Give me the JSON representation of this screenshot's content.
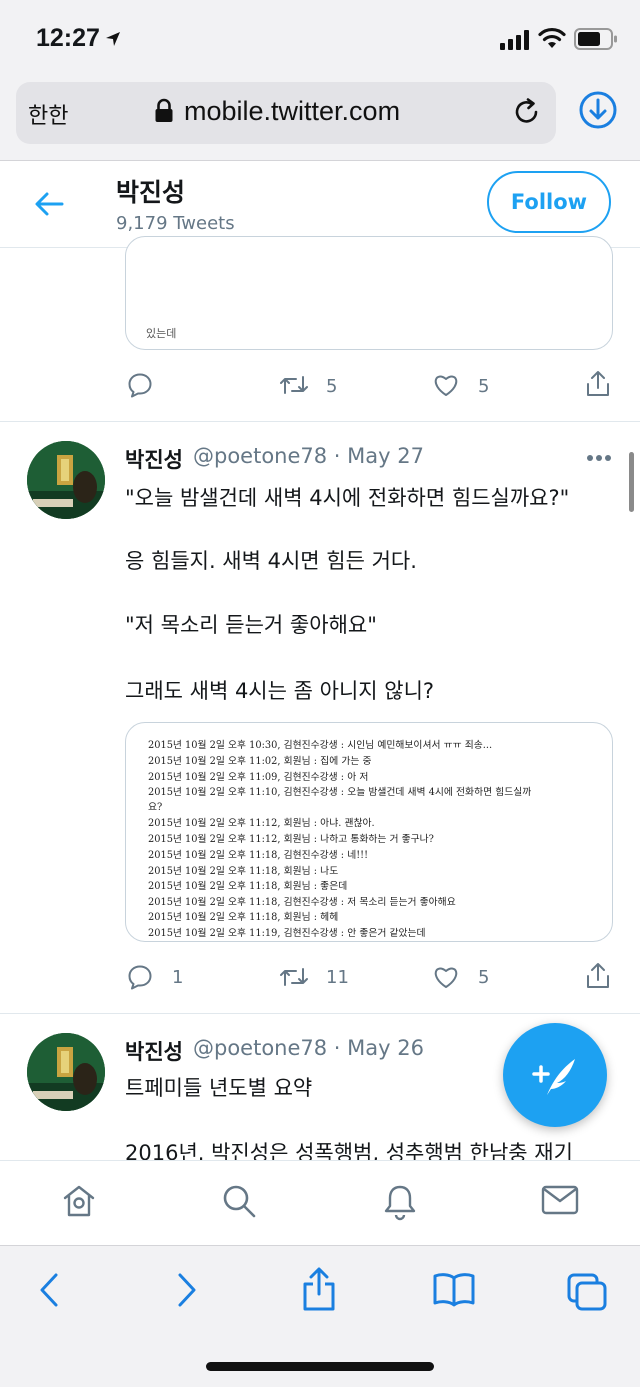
{
  "status": {
    "time": "12:27"
  },
  "browser": {
    "aa_label": "한한",
    "url": "mobile.twitter.com"
  },
  "profile": {
    "name": "박진성",
    "tweet_count": "9,179 Tweets",
    "follow_label": "Follow"
  },
  "prev_tweet": {
    "card_text": "있는데",
    "retweets": "5",
    "likes": "5"
  },
  "tweets": [
    {
      "name": "박진성",
      "handle_date": "@poetone78 · May 27",
      "lines": [
        "\"오늘 밤샐건데 새벽 4시에 전화하면 힘드실까요?\"",
        "응 힘들지. 새벽 4시면 힘든 거다.",
        "\"저 목소리 듣는거 좋아해요\"",
        "그래도 새벽 4시는 좀 아니지 않니?"
      ],
      "image_lines": [
        "2015년 10월 2일 오후 10:30, 김현진수강생 : 시인님 예민해보이셔서 ㅠㅠ 죄송...",
        "2015년 10월 2일 오후 11:02, 회원님 : 집에 가는 중",
        "2015년 10월 2일 오후 11:09, 김현진수강생 : 아 저",
        "2015년 10월 2일 오후 11:10, 김현진수강생 : 오늘 밤샐건데 새벽 4시에 전화하면 힘드실까",
        "요?",
        "2015년 10월 2일 오후 11:12, 회원님 : 아냐. 괜찮아.",
        "2015년 10월 2일 오후 11:12, 회원님 : 나하고 통화하는 거 좋구나?",
        "2015년 10월 2일 오후 11:18, 김현진수강생 : 네!!!",
        "2015년 10월 2일 오후 11:18, 회원님 : 나도",
        "2015년 10월 2일 오후 11:18, 회원님 : 좋은데",
        "2015년 10월 2일 오후 11:18, 김현진수강생 : 저 목소리 듣는거 좋아해요",
        "2015년 10월 2일 오후 11:18, 회원님 : 헤헤",
        "2015년 10월 2일 오후 11:19, 김현진수강생 : 안 좋은거 같았는데"
      ],
      "replies": "1",
      "retweets": "11",
      "likes": "5"
    },
    {
      "name": "박진성",
      "handle_date": "@poetone78 · May 26",
      "lines": [
        "트페미들 년도별 요약",
        "2016년. 박진성은 성폭행범, 성추행범 한남충 재기"
      ]
    }
  ],
  "icons": {
    "reply": "reply-icon",
    "retweet": "retweet-icon",
    "like": "heart-icon",
    "share": "share-icon",
    "home": "home-icon",
    "search": "search-icon",
    "notifications": "bell-icon",
    "messages": "mail-icon",
    "compose": "compose-icon"
  },
  "colors": {
    "accent": "#1da1f2",
    "text": "#14171a",
    "secondary": "#657786",
    "browser_blue": "#1a7fe0"
  }
}
